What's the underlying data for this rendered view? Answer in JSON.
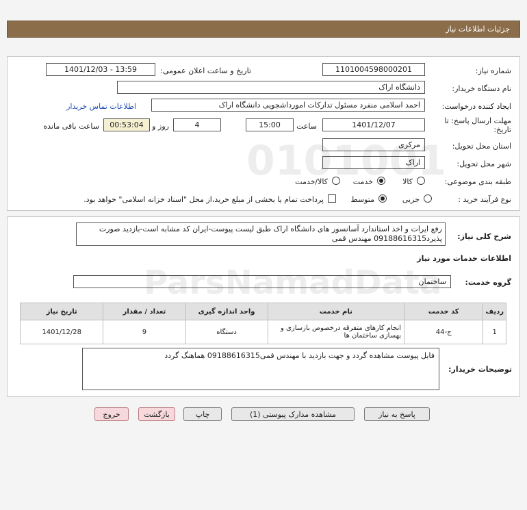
{
  "header": {
    "title": "جزئیات اطلاعات نیاز"
  },
  "form": {
    "need_number_label": "شماره نیاز:",
    "need_number": "1101004598000201",
    "announce_label": "تاریخ و ساعت اعلان عمومی:",
    "announce_value": "1401/12/03 - 13:59",
    "buyer_label": "نام دستگاه خریدار:",
    "buyer_value": "دانشگاه اراک",
    "creator_label": "ایجاد کننده درخواست:",
    "creator_value": "احمد  اسلامی منفرد مسئول تدارکات امورداشجویی دانشگاه اراک",
    "contact_link": "اطلاعات تماس خریدار",
    "deadline_label_1": "مهلت ارسال پاسخ: تا",
    "deadline_label_2": "تاریخ:",
    "deadline_date": "1401/12/07",
    "time_label": "ساعت",
    "deadline_time": "15:00",
    "days_value": "4",
    "days_label": "روز و",
    "remaining_value": "00:53:04",
    "remaining_label": "ساعت باقی مانده",
    "province_label": "استان محل تحویل:",
    "province_value": "مرکزی",
    "city_label": "شهر محل تحویل:",
    "city_value": "اراک",
    "category_label": "طبقه بندی موضوعی:",
    "category_options": [
      "کالا",
      "خدمت",
      "کالا/خدمت"
    ],
    "category_selected": "خدمت",
    "process_label": "نوع فرآیند خرید :",
    "process_options": [
      "جزیی",
      "متوسط"
    ],
    "process_selected": "متوسط",
    "payment_note": "پرداخت تمام یا بخشی از مبلغ خرید،از محل \"اسناد خزانه اسلامی\" خواهد بود."
  },
  "description": {
    "label": "شرح کلی نیاز:",
    "text": "رفع ایرات و اخذ استاندارد آسانسور های دانشگاه اراک طبق لیست پیوست-ایران کد مشابه است-بازدید صورت پذیرد09188616315 مهندس قمی"
  },
  "services": {
    "section_title": "اطلاعات خدمات مورد نیاز",
    "group_label": "گروه خدمت:",
    "group_value": "ساختمان",
    "columns": [
      "ردیف",
      "کد خدمت",
      "نام خدمت",
      "واحد اندازه گیری",
      "تعداد / مقدار",
      "تاریخ نیاز"
    ],
    "rows": [
      {
        "row": "1",
        "code": "ج-44",
        "name": "انجام کارهای متفرقه درخصوص بازسازی و بهسازی ساختمان ها",
        "unit": "دستگاه",
        "qty": "9",
        "date": "1401/12/28"
      }
    ]
  },
  "buyer_notes": {
    "label": "توضیحات خریدار:",
    "text": "فایل پیوست مشاهده گردد و جهت بازدید با مهندس قمی09188616315 هماهنگ گردد"
  },
  "buttons": {
    "reply": "پاسخ به نیاز",
    "view_docs": "مشاهده مدارک پیوستی (1)",
    "print": "چاپ",
    "back": "بازگشت",
    "exit": "خروج"
  },
  "watermark": {
    "brand": "ParsNamadData",
    "digits": "0101001"
  }
}
